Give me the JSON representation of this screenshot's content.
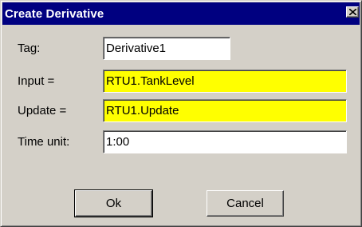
{
  "window": {
    "title": "Create Derivative",
    "close_glyph": "×"
  },
  "form": {
    "tag": {
      "label": "Tag:",
      "value": "Derivative1",
      "bg": "#ffffff"
    },
    "input": {
      "label": "Input =",
      "value": "RTU1.TankLevel",
      "bg": "#ffff00"
    },
    "update": {
      "label": "Update =",
      "value": "RTU1.Update",
      "bg": "#ffff00"
    },
    "time_unit": {
      "label": "Time unit:",
      "value": "1:00",
      "bg": "#ffffff"
    }
  },
  "buttons": {
    "ok": "Ok",
    "cancel": "Cancel"
  },
  "colors": {
    "titlebar": "#000080",
    "dialog_bg": "#d4d0c8",
    "highlight_field": "#ffff00"
  }
}
